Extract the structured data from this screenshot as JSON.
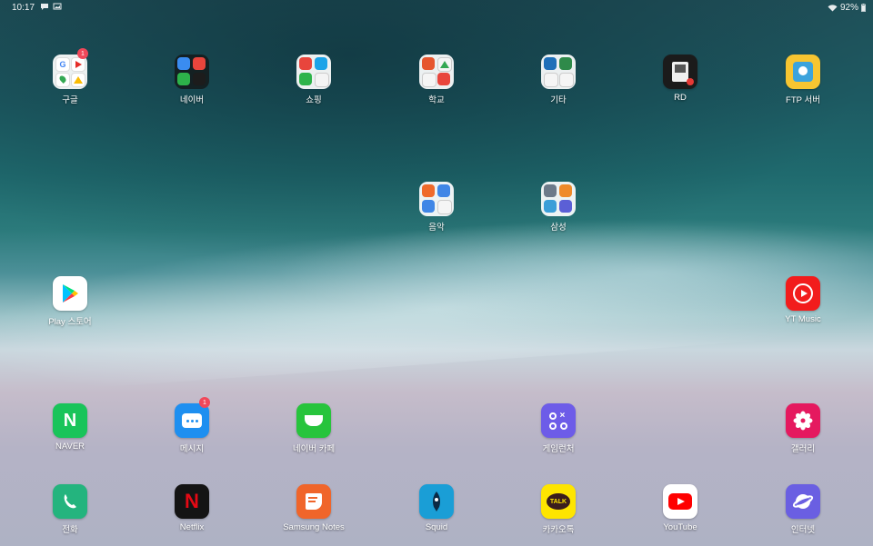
{
  "status": {
    "time": "10:17",
    "battery": "92%"
  },
  "apps": {
    "google": {
      "label": "구글",
      "badge": "1"
    },
    "naver_folder": {
      "label": "네이버"
    },
    "shopping": {
      "label": "쇼핑"
    },
    "school": {
      "label": "학교"
    },
    "etc": {
      "label": "기타"
    },
    "rd": {
      "label": "RD"
    },
    "ftp": {
      "label": "FTP 서버"
    },
    "music": {
      "label": "음악"
    },
    "samsung": {
      "label": "삼성"
    },
    "playstore": {
      "label": "Play 스토어"
    },
    "ytmusic": {
      "label": "YT Music"
    },
    "naver": {
      "label": "NAVER"
    },
    "messages": {
      "label": "메시지",
      "badge": "1"
    },
    "navercafe": {
      "label": "네이버 카페"
    },
    "gamelauncher": {
      "label": "게임런처"
    },
    "gallery": {
      "label": "갤러리"
    },
    "phone": {
      "label": "전화"
    },
    "netflix": {
      "label": "Netflix"
    },
    "samsungnotes": {
      "label": "Samsung Notes"
    },
    "squid": {
      "label": "Squid"
    },
    "kakaotalk": {
      "label": "카카오톡",
      "icon_text": "TALK"
    },
    "youtube": {
      "label": "YouTube"
    },
    "internet": {
      "label": "인터넷"
    }
  }
}
